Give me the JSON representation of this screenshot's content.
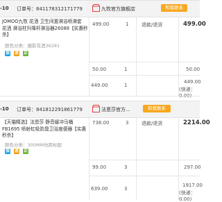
{
  "orders": [
    {
      "date_fragment": "-10",
      "order_label": "订单号：",
      "order_no": "841178312171779",
      "shop_name": "九牧官方旗舰店",
      "contact_label": "和我联系",
      "item": {
        "title_lines": [
          "JOMOO九牧 花洒 卫生间置淋浴喷淋套",
          "花洒 淋浴柱升降杆淋浴器26088【实惠秒",
          "杀】"
        ],
        "spec": "颜色分类：摄影花洒36281",
        "badges": [
          "保",
          "退",
          "正"
        ],
        "price": "499.00",
        "qty": "1",
        "status": "退款/退货",
        "total": "499.00"
      },
      "service": {
        "price": "50.00",
        "qty": "1",
        "total": "50.00"
      },
      "summary": {
        "price": "449.00",
        "qty": "1",
        "total": "449.00",
        "shipping": "(快递：0.00)"
      }
    },
    {
      "date_fragment": "-10",
      "order_label": "订单号：",
      "order_no": "841812291861779",
      "shop_name": "法恩莎官方...",
      "contact_label": "和我联系",
      "item": {
        "title_lines": [
          "【天猫精选】法恩莎 静音缓冲马桶",
          "FB1695 喷射虹吸防臭卫浴座便器【实惠",
          "秒杀】"
        ],
        "spec": "颜色分类：300MM坑距标配",
        "badges": [
          "保",
          "退",
          "正"
        ],
        "price": "738.00",
        "qty": "3",
        "status": "退款/退货",
        "total": "2214.00"
      },
      "service": {
        "price": "99.00",
        "qty": "3",
        "total": "297.00"
      },
      "summary": {
        "price": "639.00",
        "qty": "3",
        "total": "1917.00",
        "shipping": "(快递：0.00)"
      }
    }
  ],
  "colors": {
    "header_bg": "#f3f3f3",
    "contact_orange": "#f7a81d",
    "badge_blue": "#1aa3e8",
    "badge_orange": "#f39c11",
    "badge_green": "#6cb33e"
  }
}
